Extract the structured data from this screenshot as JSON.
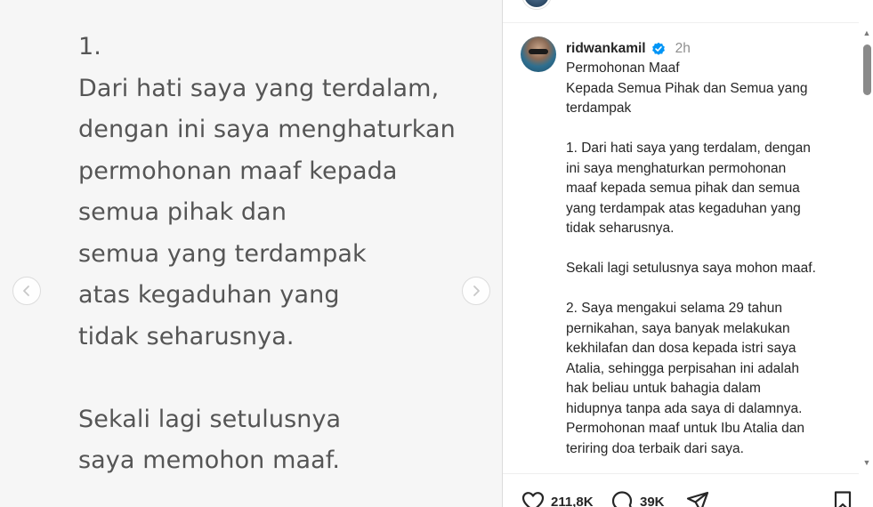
{
  "media": {
    "slide_lines_1": [
      "1.",
      "Dari hati saya yang terdalam,",
      "dengan ini saya menghaturkan",
      "permohonan maaf kepada",
      "semua pihak dan",
      "semua yang terdampak",
      "atas kegaduhan yang",
      "tidak seharusnya."
    ],
    "slide_lines_2": [
      "Sekali lagi setulusnya",
      "saya memohon maaf."
    ]
  },
  "post": {
    "username": "ridwankamil",
    "time": "2h",
    "caption_block_1": [
      "Permohonan Maaf",
      "Kepada Semua Pihak dan Semua yang",
      "terdampak"
    ],
    "caption_block_2": [
      "1. Dari hati saya yang terdalam, dengan",
      "ini saya menghaturkan permohonan",
      "maaf kepada semua pihak dan semua",
      "yang terdampak atas kegaduhan yang",
      "tidak seharusnya."
    ],
    "caption_block_3": [
      "Sekali lagi setulusnya saya mohon maaf."
    ],
    "caption_block_4": [
      "2. Saya mengakui selama 29 tahun",
      "pernikahan, saya banyak melakukan",
      "kekhilafan dan dosa kepada istri saya",
      "Atalia, sehingga perpisahan ini adalah",
      "hak beliau untuk bahagia dalam",
      "hidupnya tanpa ada saya di dalamnya.",
      "Permohonan maaf untuk Ibu Atalia dan",
      "teriring doa terbaik dari saya."
    ]
  },
  "actions": {
    "likes": "211,8K",
    "comments": "39K"
  },
  "colors": {
    "verified": "#0095f6",
    "text": "#262626",
    "muted": "#8e8e8e",
    "slide_text": "#555555"
  }
}
